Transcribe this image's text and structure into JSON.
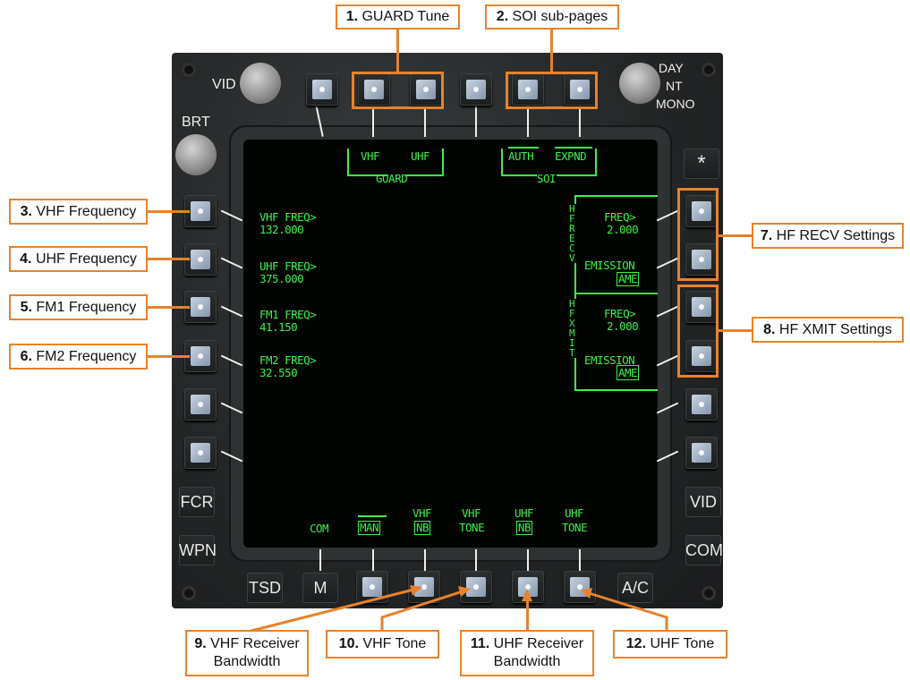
{
  "callouts": {
    "c1": {
      "num": "1.",
      "text": "GUARD Tune"
    },
    "c2": {
      "num": "2.",
      "text": "SOI sub-pages"
    },
    "c3": {
      "num": "3.",
      "text": "VHF Frequency"
    },
    "c4": {
      "num": "4.",
      "text": "UHF Frequency"
    },
    "c5": {
      "num": "5.",
      "text": "FM1 Frequency"
    },
    "c6": {
      "num": "6.",
      "text": "FM2 Frequency"
    },
    "c7": {
      "num": "7.",
      "text": "HF RECV Settings"
    },
    "c8": {
      "num": "8.",
      "text": "HF XMIT Settings"
    },
    "c9": {
      "num": "9.",
      "text": "VHF Receiver",
      "text2": "Bandwidth"
    },
    "c10": {
      "num": "10.",
      "text": "VHF Tone"
    },
    "c11": {
      "num": "11.",
      "text": "UHF Receiver",
      "text2": "Bandwidth"
    },
    "c12": {
      "num": "12.",
      "text": "UHF Tone"
    }
  },
  "bezel": {
    "vid_knob": "VID",
    "brt_knob": "BRT",
    "mode_knob": [
      "DAY",
      "NT",
      "MONO"
    ],
    "star": "*",
    "left_keys": [
      "FCR",
      "WPN"
    ],
    "right_keys": [
      "VID",
      "COM"
    ],
    "bottom_keys": [
      "TSD",
      "M",
      "A/C"
    ]
  },
  "screen": {
    "top": {
      "guard_vhf": "VHF",
      "guard_uhf": "UHF",
      "guard_label": "GUARD",
      "soi_auth": "AUTH",
      "soi_expnd": "EXPND",
      "soi_label": "SOI"
    },
    "left": [
      {
        "label": "VHF FREQ>",
        "value": "132.000"
      },
      {
        "label": "UHF FREQ>",
        "value": "375.000"
      },
      {
        "label": "FM1 FREQ>",
        "value": "41.150"
      },
      {
        "label": "FM2 FREQ>",
        "value": "32.550"
      }
    ],
    "hf_recv": {
      "side_label": "HF RECV",
      "freq_label": "FREQ>",
      "freq_value": "2.000",
      "emission_label": "EMISSION",
      "emission_value": "AME"
    },
    "hf_xmit": {
      "side_label": "HF XMIT",
      "freq_label": "FREQ>",
      "freq_value": "2.000",
      "emission_label": "EMISSION",
      "emission_value": "AME"
    },
    "bottom": {
      "com": "COM",
      "man": "MAN",
      "vhf_nb_top": "VHF",
      "vhf_nb": "NB",
      "vhf_tone_top": "VHF",
      "vhf_tone": "TONE",
      "uhf_nb_top": "UHF",
      "uhf_nb": "NB",
      "uhf_tone_top": "UHF",
      "uhf_tone": "TONE"
    }
  },
  "colors": {
    "symbology": "#3cf04a",
    "callout_border": "#e8822a"
  }
}
